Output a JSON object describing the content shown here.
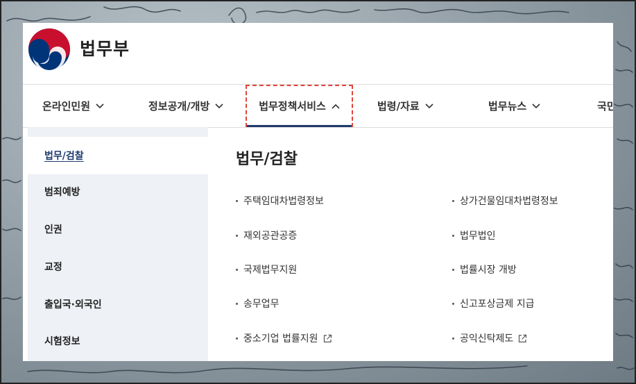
{
  "brand": {
    "name": "법무부"
  },
  "nav": {
    "items": [
      {
        "label": "온라인민원"
      },
      {
        "label": "정보공개/개방"
      },
      {
        "label": "법무정책서비스"
      },
      {
        "label": "법령/자료"
      },
      {
        "label": "법무뉴스"
      },
      {
        "label": "국민"
      }
    ],
    "active_index": 2
  },
  "sidebar": {
    "items": [
      {
        "label": "법무/검찰"
      },
      {
        "label": "범죄예방"
      },
      {
        "label": "인권"
      },
      {
        "label": "교정"
      },
      {
        "label": "출입국·외국인"
      },
      {
        "label": "시험정보"
      }
    ],
    "active_index": 0
  },
  "content": {
    "title": "법무/검찰",
    "links_left": [
      {
        "label": "주택임대차법령정보"
      },
      {
        "label": "재외공관공증"
      },
      {
        "label": "국제법무지원"
      },
      {
        "label": "송무업무"
      },
      {
        "label": "중소기업 법률지원"
      }
    ],
    "links_right": [
      {
        "label": "상가건물임대차법령정보"
      },
      {
        "label": "법무법인"
      },
      {
        "label": "법률시장 개방"
      },
      {
        "label": "신고포상금제 지급"
      },
      {
        "label": "공익신탁제도"
      }
    ]
  },
  "colors": {
    "accent": "#1f3b6d",
    "focus_outline": "#e0443a",
    "sidebar_bg": "#eef1f5",
    "logo_red": "#c8102e",
    "logo_blue": "#003478"
  },
  "icons": {
    "external": "external-link-icon",
    "chevron_down": "chevron-down-icon",
    "chevron_up": "chevron-up-icon"
  }
}
